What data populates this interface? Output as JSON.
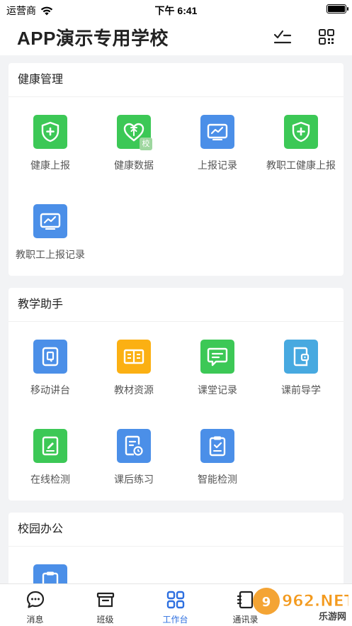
{
  "status_bar": {
    "carrier": "运营商",
    "time": "下午 6:41"
  },
  "header": {
    "title": "APP演示专用学校"
  },
  "sections": [
    {
      "title": "健康管理",
      "items": [
        {
          "label": "健康上报",
          "icon": "shield-plus-icon",
          "color": "#3cc856"
        },
        {
          "label": "健康数据",
          "icon": "heart-upload-icon",
          "color": "#3cc856",
          "badge": "校"
        },
        {
          "label": "上报记录",
          "icon": "chart-screen-icon",
          "color": "#4b8fe8"
        },
        {
          "label": "教职工健康上报",
          "icon": "shield-plus-icon",
          "color": "#3cc856"
        },
        {
          "label": "教职工上报记录",
          "icon": "chart-screen-icon",
          "color": "#4b8fe8"
        }
      ]
    },
    {
      "title": "教学助手",
      "items": [
        {
          "label": "移动讲台",
          "icon": "mobile-podium-icon",
          "color": "#4b8fe8"
        },
        {
          "label": "教材资源",
          "icon": "open-book-icon",
          "color": "#fbb013"
        },
        {
          "label": "课堂记录",
          "icon": "chat-bubble-icon",
          "color": "#3cc856"
        },
        {
          "label": "课前导学",
          "icon": "wallet-book-icon",
          "color": "#47a9e0"
        },
        {
          "label": "在线检测",
          "icon": "edit-doc-icon",
          "color": "#3cc856"
        },
        {
          "label": "课后练习",
          "icon": "doc-clock-icon",
          "color": "#4b8fe8"
        },
        {
          "label": "智能检测",
          "icon": "clipboard-check-icon",
          "color": "#4b8fe8"
        }
      ]
    },
    {
      "title": "校园办公",
      "items": [
        {
          "label": "",
          "icon": "clipboard-icon",
          "color": "#4b8fe8"
        }
      ]
    }
  ],
  "tabs": [
    {
      "label": "消息",
      "icon": "message-icon",
      "active": false
    },
    {
      "label": "班级",
      "icon": "class-box-icon",
      "active": false
    },
    {
      "label": "工作台",
      "icon": "workbench-grid-icon",
      "active": true
    },
    {
      "label": "通讯录",
      "icon": "contacts-book-icon",
      "active": false
    }
  ],
  "colors": {
    "accent": "#2d6fe0",
    "green": "#3cc856",
    "blue": "#4b8fe8",
    "orange": "#fbb013"
  },
  "watermark": {
    "text": "962.NET",
    "subtext": "乐游网"
  }
}
